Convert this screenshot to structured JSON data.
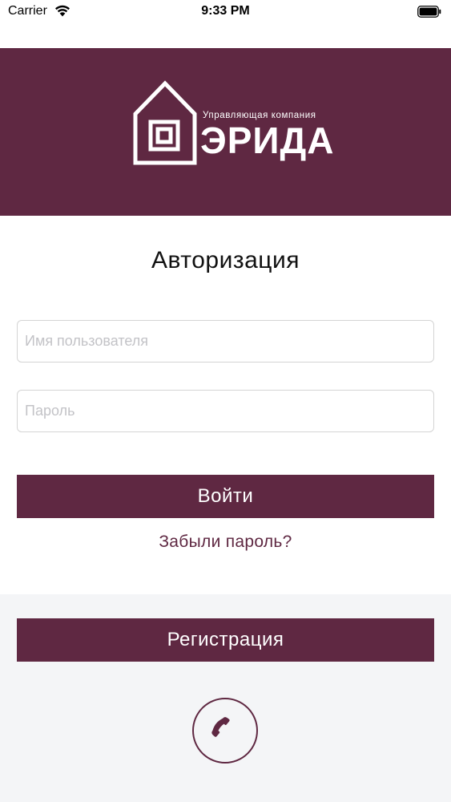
{
  "status_bar": {
    "carrier": "Carrier",
    "time": "9:33 PM"
  },
  "header": {
    "logo_tagline": "Управляющая компания",
    "logo_name": "ЭРИДА",
    "background_color": "#5f2842"
  },
  "login_form": {
    "title": "Авторизация",
    "username_placeholder": "Имя пользователя",
    "username_value": "",
    "password_placeholder": "Пароль",
    "password_value": "",
    "login_button_label": "Войти",
    "forgot_password_link": "Забыли пароль?"
  },
  "bottom": {
    "register_button_label": "Регистрация",
    "phone_icon": "phone-icon"
  },
  "colors": {
    "accent": "#5f2842",
    "bottom_panel": "#f4f5f7",
    "input_border": "#d4d4d4"
  }
}
